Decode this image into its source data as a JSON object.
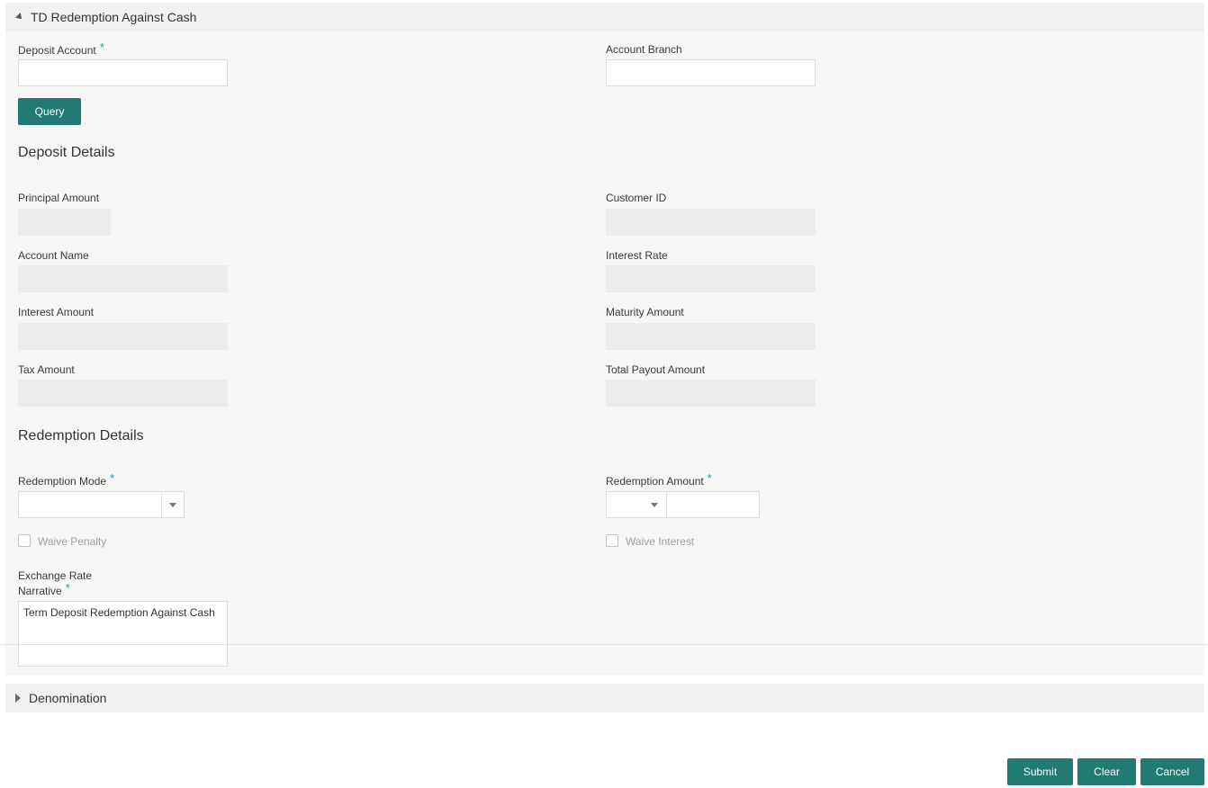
{
  "panel": {
    "title": "TD Redemption Against Cash"
  },
  "query_section": {
    "deposit_account": {
      "label": "Deposit Account",
      "required": "*",
      "value": ""
    },
    "account_branch": {
      "label": "Account Branch",
      "value": ""
    },
    "query_button": "Query"
  },
  "deposit_details": {
    "title": "Deposit Details",
    "principal_amount": {
      "label": "Principal Amount",
      "value": ""
    },
    "customer_id": {
      "label": "Customer ID",
      "value": ""
    },
    "account_name": {
      "label": "Account Name",
      "value": ""
    },
    "interest_rate": {
      "label": "Interest Rate",
      "value": ""
    },
    "interest_amount": {
      "label": "Interest Amount",
      "value": ""
    },
    "maturity_amount": {
      "label": "Maturity Amount",
      "value": ""
    },
    "tax_amount": {
      "label": "Tax Amount",
      "value": ""
    },
    "total_payout_amount": {
      "label": "Total Payout Amount",
      "value": ""
    }
  },
  "redemption_details": {
    "title": "Redemption Details",
    "redemption_mode": {
      "label": "Redemption Mode",
      "required": "*",
      "selected": ""
    },
    "redemption_amount": {
      "label": "Redemption Amount",
      "required": "*",
      "currency": "",
      "value": ""
    },
    "waive_penalty": {
      "label": "Waive Penalty",
      "checked": false
    },
    "waive_interest": {
      "label": "Waive Interest",
      "checked": false
    },
    "exchange_rate": {
      "label": "Exchange Rate"
    },
    "narrative": {
      "label": "Narrative",
      "required": "*",
      "value": "Term Deposit Redemption Against Cash"
    }
  },
  "denomination": {
    "title": "Denomination"
  },
  "footer": {
    "submit": "Submit",
    "clear": "Clear",
    "cancel": "Cancel"
  },
  "colors": {
    "accent": "#227a74",
    "required": "#1e9bb0",
    "panel_bg": "#f7f7f7",
    "readonly_bg": "#ececec"
  },
  "icons": {
    "panel_toggle": "triangle-collapse-icon",
    "denomination_toggle": "triangle-expand-icon",
    "select_caret": "chevron-down-icon"
  }
}
